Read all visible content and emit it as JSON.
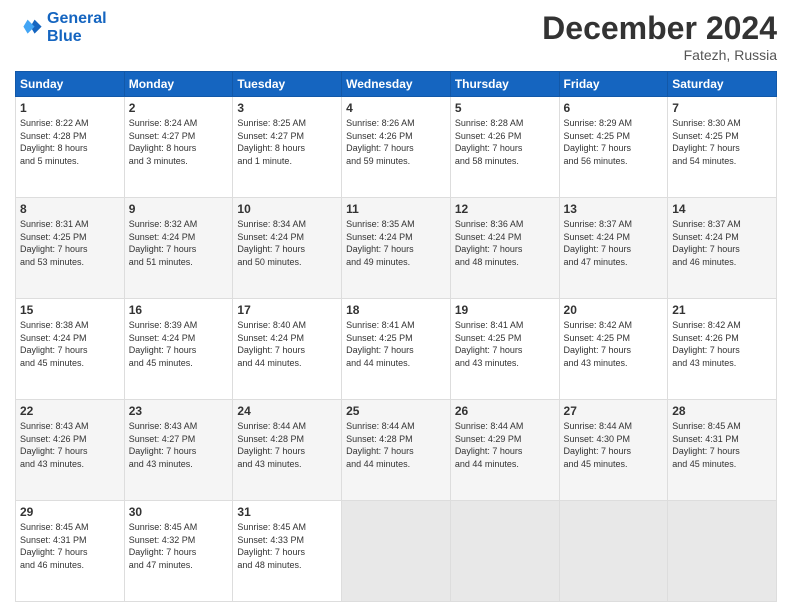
{
  "header": {
    "logo_line1": "General",
    "logo_line2": "Blue",
    "month": "December 2024",
    "location": "Fatezh, Russia"
  },
  "days_of_week": [
    "Sunday",
    "Monday",
    "Tuesday",
    "Wednesday",
    "Thursday",
    "Friday",
    "Saturday"
  ],
  "weeks": [
    [
      {
        "day": 1,
        "lines": [
          "Sunrise: 8:22 AM",
          "Sunset: 4:28 PM",
          "Daylight: 8 hours",
          "and 5 minutes."
        ]
      },
      {
        "day": 2,
        "lines": [
          "Sunrise: 8:24 AM",
          "Sunset: 4:27 PM",
          "Daylight: 8 hours",
          "and 3 minutes."
        ]
      },
      {
        "day": 3,
        "lines": [
          "Sunrise: 8:25 AM",
          "Sunset: 4:27 PM",
          "Daylight: 8 hours",
          "and 1 minute."
        ]
      },
      {
        "day": 4,
        "lines": [
          "Sunrise: 8:26 AM",
          "Sunset: 4:26 PM",
          "Daylight: 7 hours",
          "and 59 minutes."
        ]
      },
      {
        "day": 5,
        "lines": [
          "Sunrise: 8:28 AM",
          "Sunset: 4:26 PM",
          "Daylight: 7 hours",
          "and 58 minutes."
        ]
      },
      {
        "day": 6,
        "lines": [
          "Sunrise: 8:29 AM",
          "Sunset: 4:25 PM",
          "Daylight: 7 hours",
          "and 56 minutes."
        ]
      },
      {
        "day": 7,
        "lines": [
          "Sunrise: 8:30 AM",
          "Sunset: 4:25 PM",
          "Daylight: 7 hours",
          "and 54 minutes."
        ]
      }
    ],
    [
      {
        "day": 8,
        "lines": [
          "Sunrise: 8:31 AM",
          "Sunset: 4:25 PM",
          "Daylight: 7 hours",
          "and 53 minutes."
        ]
      },
      {
        "day": 9,
        "lines": [
          "Sunrise: 8:32 AM",
          "Sunset: 4:24 PM",
          "Daylight: 7 hours",
          "and 51 minutes."
        ]
      },
      {
        "day": 10,
        "lines": [
          "Sunrise: 8:34 AM",
          "Sunset: 4:24 PM",
          "Daylight: 7 hours",
          "and 50 minutes."
        ]
      },
      {
        "day": 11,
        "lines": [
          "Sunrise: 8:35 AM",
          "Sunset: 4:24 PM",
          "Daylight: 7 hours",
          "and 49 minutes."
        ]
      },
      {
        "day": 12,
        "lines": [
          "Sunrise: 8:36 AM",
          "Sunset: 4:24 PM",
          "Daylight: 7 hours",
          "and 48 minutes."
        ]
      },
      {
        "day": 13,
        "lines": [
          "Sunrise: 8:37 AM",
          "Sunset: 4:24 PM",
          "Daylight: 7 hours",
          "and 47 minutes."
        ]
      },
      {
        "day": 14,
        "lines": [
          "Sunrise: 8:37 AM",
          "Sunset: 4:24 PM",
          "Daylight: 7 hours",
          "and 46 minutes."
        ]
      }
    ],
    [
      {
        "day": 15,
        "lines": [
          "Sunrise: 8:38 AM",
          "Sunset: 4:24 PM",
          "Daylight: 7 hours",
          "and 45 minutes."
        ]
      },
      {
        "day": 16,
        "lines": [
          "Sunrise: 8:39 AM",
          "Sunset: 4:24 PM",
          "Daylight: 7 hours",
          "and 45 minutes."
        ]
      },
      {
        "day": 17,
        "lines": [
          "Sunrise: 8:40 AM",
          "Sunset: 4:24 PM",
          "Daylight: 7 hours",
          "and 44 minutes."
        ]
      },
      {
        "day": 18,
        "lines": [
          "Sunrise: 8:41 AM",
          "Sunset: 4:25 PM",
          "Daylight: 7 hours",
          "and 44 minutes."
        ]
      },
      {
        "day": 19,
        "lines": [
          "Sunrise: 8:41 AM",
          "Sunset: 4:25 PM",
          "Daylight: 7 hours",
          "and 43 minutes."
        ]
      },
      {
        "day": 20,
        "lines": [
          "Sunrise: 8:42 AM",
          "Sunset: 4:25 PM",
          "Daylight: 7 hours",
          "and 43 minutes."
        ]
      },
      {
        "day": 21,
        "lines": [
          "Sunrise: 8:42 AM",
          "Sunset: 4:26 PM",
          "Daylight: 7 hours",
          "and 43 minutes."
        ]
      }
    ],
    [
      {
        "day": 22,
        "lines": [
          "Sunrise: 8:43 AM",
          "Sunset: 4:26 PM",
          "Daylight: 7 hours",
          "and 43 minutes."
        ]
      },
      {
        "day": 23,
        "lines": [
          "Sunrise: 8:43 AM",
          "Sunset: 4:27 PM",
          "Daylight: 7 hours",
          "and 43 minutes."
        ]
      },
      {
        "day": 24,
        "lines": [
          "Sunrise: 8:44 AM",
          "Sunset: 4:28 PM",
          "Daylight: 7 hours",
          "and 43 minutes."
        ]
      },
      {
        "day": 25,
        "lines": [
          "Sunrise: 8:44 AM",
          "Sunset: 4:28 PM",
          "Daylight: 7 hours",
          "and 44 minutes."
        ]
      },
      {
        "day": 26,
        "lines": [
          "Sunrise: 8:44 AM",
          "Sunset: 4:29 PM",
          "Daylight: 7 hours",
          "and 44 minutes."
        ]
      },
      {
        "day": 27,
        "lines": [
          "Sunrise: 8:44 AM",
          "Sunset: 4:30 PM",
          "Daylight: 7 hours",
          "and 45 minutes."
        ]
      },
      {
        "day": 28,
        "lines": [
          "Sunrise: 8:45 AM",
          "Sunset: 4:31 PM",
          "Daylight: 7 hours",
          "and 45 minutes."
        ]
      }
    ],
    [
      {
        "day": 29,
        "lines": [
          "Sunrise: 8:45 AM",
          "Sunset: 4:31 PM",
          "Daylight: 7 hours",
          "and 46 minutes."
        ]
      },
      {
        "day": 30,
        "lines": [
          "Sunrise: 8:45 AM",
          "Sunset: 4:32 PM",
          "Daylight: 7 hours",
          "and 47 minutes."
        ]
      },
      {
        "day": 31,
        "lines": [
          "Sunrise: 8:45 AM",
          "Sunset: 4:33 PM",
          "Daylight: 7 hours",
          "and 48 minutes."
        ]
      },
      null,
      null,
      null,
      null
    ]
  ]
}
